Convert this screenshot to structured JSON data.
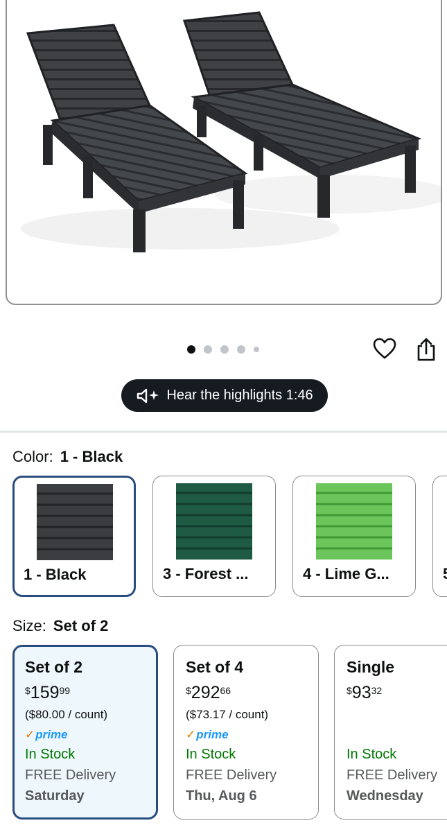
{
  "product_image": {
    "alt": "Two black slatted chaise lounge chairs"
  },
  "carousel": {
    "count": 5,
    "active_index": 0
  },
  "actions": {
    "favorite_icon": "heart-icon",
    "share_icon": "share-icon"
  },
  "audio": {
    "label": "Hear the highlights 1:46",
    "icon": "speaker-sparkle-icon"
  },
  "color": {
    "label": "Color:",
    "selected": "1 - Black",
    "options": [
      {
        "name": "1 - Black",
        "swatch_color": "#3c3d40",
        "selected": true
      },
      {
        "name": "3 - Forest ...",
        "swatch_color": "#1f5a45",
        "selected": false
      },
      {
        "name": "4 - Lime G...",
        "swatch_color": "#6cc55a",
        "selected": false
      },
      {
        "name": "5",
        "swatch_color": "#ffffff",
        "selected": false
      }
    ]
  },
  "size": {
    "label": "Size:",
    "selected": "Set of 2",
    "options": [
      {
        "name": "Set of 2",
        "currency": "$",
        "price_whole": "159",
        "price_fraction": "99",
        "unit_price": "($80.00 / count)",
        "prime": "prime",
        "stock": "In Stock",
        "delivery": "FREE Delivery",
        "delivery_day": "Saturday",
        "selected": true
      },
      {
        "name": "Set of 4",
        "currency": "$",
        "price_whole": "292",
        "price_fraction": "66",
        "unit_price": "($73.17 / count)",
        "prime": "prime",
        "stock": "In Stock",
        "delivery": "FREE Delivery",
        "delivery_day": "Thu, Aug 6",
        "selected": false
      },
      {
        "name": "Single",
        "currency": "$",
        "price_whole": "93",
        "price_fraction": "32",
        "unit_price": "",
        "prime": "",
        "stock": "In Stock",
        "delivery": "FREE Delivery",
        "delivery_day": "Wednesday",
        "selected": false
      }
    ]
  },
  "colors": {
    "selected_border": "#2a4d80",
    "selected_bg": "#eef7fc",
    "in_stock": "#007600",
    "prime_blue": "#1a98ff",
    "prime_check": "#e77600"
  }
}
